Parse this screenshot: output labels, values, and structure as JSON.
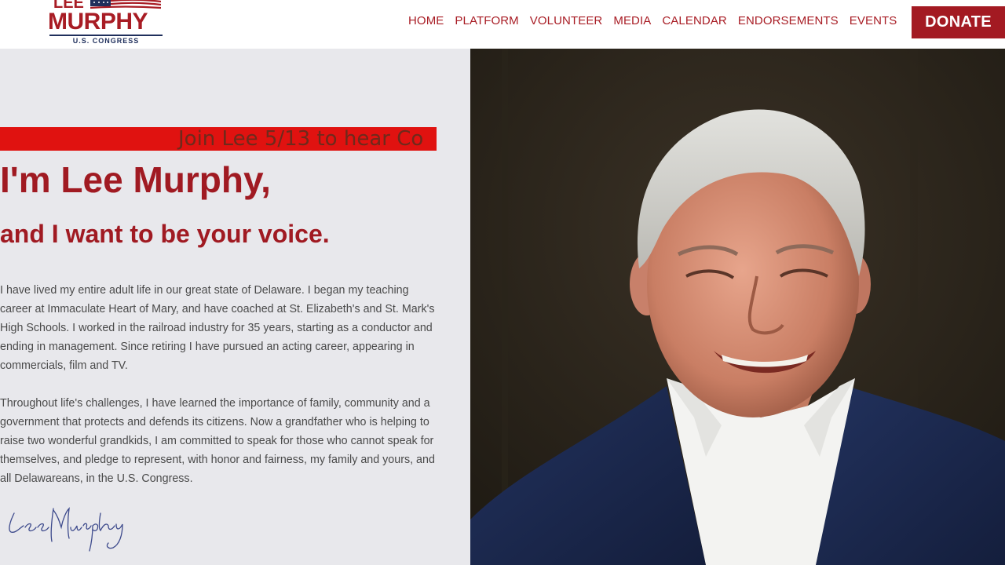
{
  "logo": {
    "line1": "LEE",
    "line2": "MURPHY",
    "line3": "U.S. CONGRESS"
  },
  "nav": {
    "items": [
      "HOME",
      "PLATFORM",
      "VOLUNTEER",
      "MEDIA",
      "CALENDAR",
      "ENDORSEMENTS",
      "EVENTS"
    ],
    "donate_label": "DONATE"
  },
  "hero": {
    "ticker_text": "Join Lee 5/13 to hear Co",
    "headline": "I'm Lee Murphy,",
    "subheadline": "and I want to be your voice.",
    "paragraph1": "I have lived my entire adult life in our great state of Delaware. I began my teaching career at Immaculate Heart of Mary, and have coached at St. Elizabeth's and St. Mark's High Schools. I worked in the railroad industry for 35 years, starting as a conductor and ending in management. Since retiring I have pursued an acting career, appearing in commercials, film and TV.",
    "paragraph2": "Throughout life's challenges, I have learned the importance of family, community and a government that protects and defends its citizens. Now a grandfather who is helping to raise two wonderful grandkids, I am committed to speak for those who cannot speak for themselves, and pledge to represent, with honor and fairness, my family and yours, and all Delawareans, in the U.S. Congress.",
    "signature": "Lee Murphy"
  },
  "colors": {
    "brand_red": "#a81c24",
    "navy": "#1f2f5c",
    "ticker_red": "#e01210",
    "panel_bg": "#e8e8ec"
  }
}
